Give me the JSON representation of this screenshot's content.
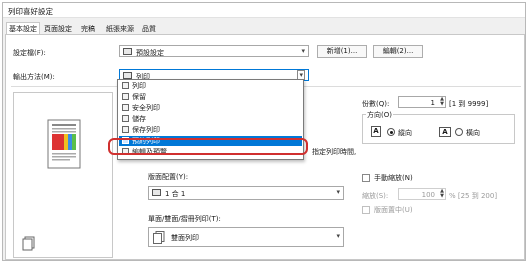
{
  "window": {
    "title": "列印喜好設定"
  },
  "tabs": [
    {
      "label": "基本設定",
      "active": true
    },
    {
      "label": "頁面設定",
      "active": false
    },
    {
      "label": "完稿",
      "active": false
    },
    {
      "label": "紙張來源",
      "active": false
    },
    {
      "label": "品質",
      "active": false
    }
  ],
  "profile": {
    "label": "設定檔(F):",
    "value": "預設設定",
    "add_label": "新增(1)...",
    "edit_label": "編輯(2)..."
  },
  "output": {
    "label": "輸出方法(M):",
    "value": "列印"
  },
  "dropdown": {
    "items": [
      {
        "label": "列印",
        "selected": false
      },
      {
        "label": "保留",
        "selected": false
      },
      {
        "label": "安全列印",
        "selected": false
      },
      {
        "label": "儲存",
        "selected": false
      },
      {
        "label": "保存列印",
        "selected": false
      },
      {
        "label": "預約列印",
        "selected": true
      },
      {
        "label": "編輯及預覽",
        "selected": false
      }
    ]
  },
  "schedule_hint": "指定列印時間,",
  "copies": {
    "label": "份數(Q):",
    "value": "1",
    "range": "[1 到 9999]"
  },
  "orientation": {
    "label": "方向(O)",
    "portrait": "縱向",
    "landscape": "橫向",
    "selected": "portrait"
  },
  "layout": {
    "label": "版面配置(Y):",
    "value": "1 合 1"
  },
  "manual_scaling": {
    "label": "手動縮放(N)",
    "checked": false
  },
  "scaling": {
    "label": "縮放(S):",
    "value": "100",
    "range": "% [25 到 200]"
  },
  "center": {
    "label": "版面置中(U)",
    "checked": false
  },
  "duplex": {
    "label": "單面/雙面/摺冊列印(T):",
    "value": "雙面列印"
  },
  "colors": {
    "accent": "#0078d7",
    "highlight": "#d0302f"
  }
}
